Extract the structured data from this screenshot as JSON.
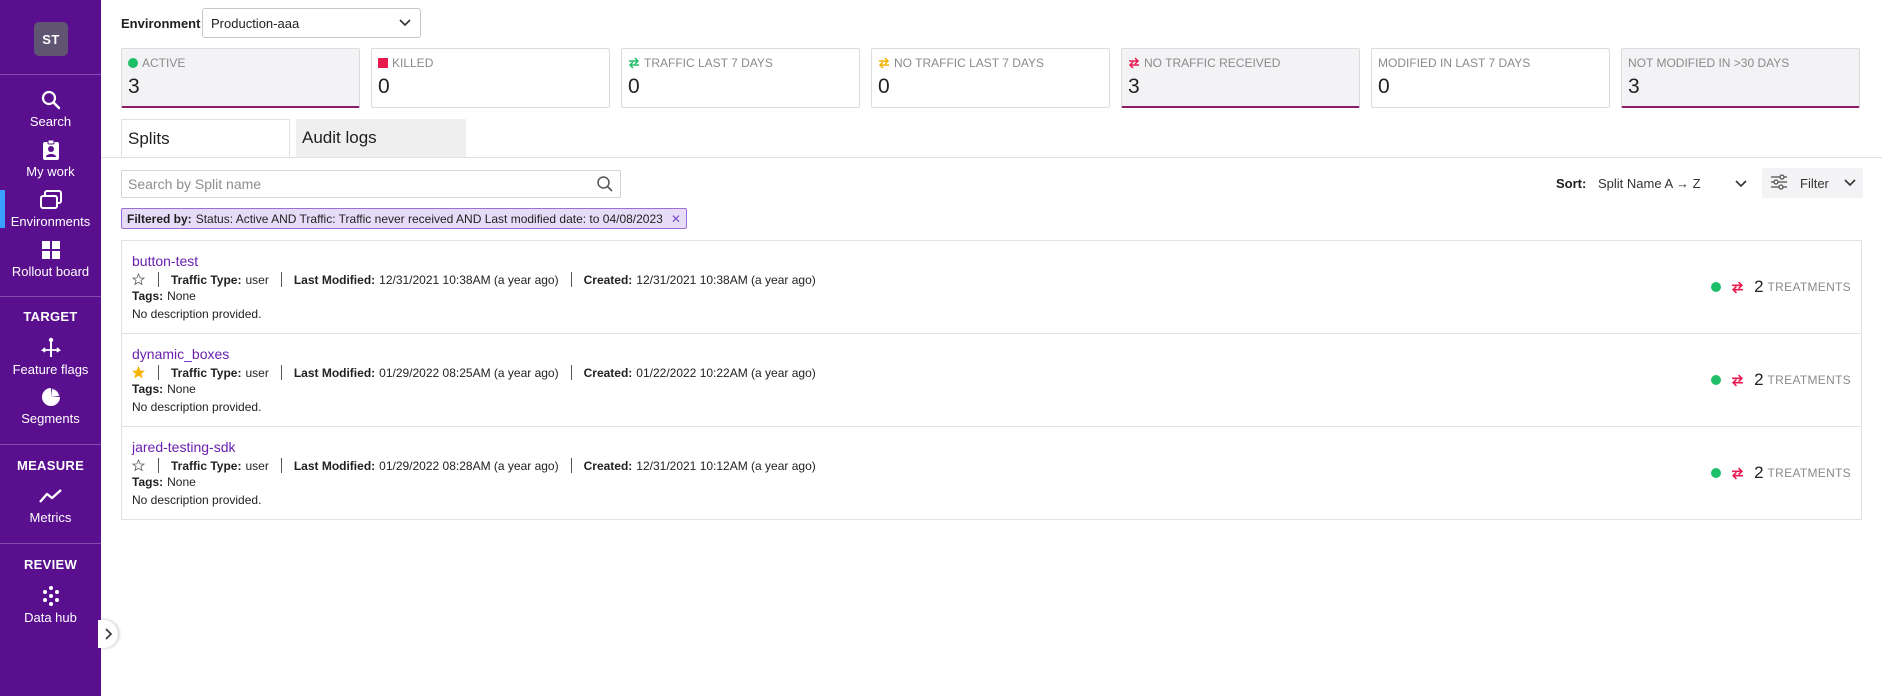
{
  "sidebar": {
    "avatar": "ST",
    "items": [
      {
        "label": "Search",
        "icon": "search-icon"
      },
      {
        "label": "My work",
        "icon": "clipboard-user-icon"
      },
      {
        "label": "Environments",
        "icon": "windows-icon"
      },
      {
        "label": "Rollout board",
        "icon": "grid-icon"
      },
      {
        "label": "Feature flags",
        "icon": "flag-branch-icon"
      },
      {
        "label": "Segments",
        "icon": "pie-chart-icon"
      },
      {
        "label": "Metrics",
        "icon": "line-chart-icon"
      },
      {
        "label": "Data hub",
        "icon": "data-dots-icon"
      }
    ],
    "sections": [
      "TARGET",
      "MEASURE",
      "REVIEW"
    ]
  },
  "environment": {
    "label": "Environment",
    "value": "Production-aaa"
  },
  "stats": [
    {
      "label": "ACTIVE",
      "value": "3",
      "icon": "green-dot-icon"
    },
    {
      "label": "KILLED",
      "value": "0",
      "icon": "red-square-icon"
    },
    {
      "label": "TRAFFIC LAST 7 DAYS",
      "value": "0",
      "icon": "traffic-arrows-icon"
    },
    {
      "label": "NO TRAFFIC LAST 7 DAYS",
      "value": "0",
      "icon": "no-traffic-arrows-icon"
    },
    {
      "label": "NO TRAFFIC RECEIVED",
      "value": "3",
      "icon": "no-traffic-received-icon"
    },
    {
      "label": "MODIFIED IN LAST 7 DAYS",
      "value": "0",
      "icon": ""
    },
    {
      "label": "NOT MODIFIED IN >30 DAYS",
      "value": "3",
      "icon": ""
    }
  ],
  "tabs": [
    {
      "label": "Splits"
    },
    {
      "label": "Audit logs"
    }
  ],
  "search": {
    "placeholder": "Search by Split name",
    "value": ""
  },
  "sort": {
    "label": "Sort:",
    "value": "Split Name A → Z"
  },
  "filter": {
    "label": "Filter"
  },
  "chip": {
    "prefix": "Filtered by:",
    "text": "Status: Active AND Traffic: Traffic never received AND Last modified date: to 04/08/2023"
  },
  "labels": {
    "traffic_type": "Traffic Type:",
    "last_modified": "Last Modified:",
    "created": "Created:",
    "tags": "Tags:",
    "treatments": "TREATMENTS"
  },
  "splits": [
    {
      "name": "button-test",
      "starred": false,
      "traffic_type": "user",
      "last_modified": "12/31/2021 10:38AM (a year ago)",
      "created": "12/31/2021 10:38AM (a year ago)",
      "tags": "None",
      "description": "No description provided.",
      "treatments": "2"
    },
    {
      "name": "dynamic_boxes",
      "starred": true,
      "traffic_type": "user",
      "last_modified": "01/29/2022 08:25AM (a year ago)",
      "created": "01/22/2022 10:22AM (a year ago)",
      "tags": "None",
      "description": "No description provided.",
      "treatments": "2"
    },
    {
      "name": "jared-testing-sdk",
      "starred": false,
      "traffic_type": "user",
      "last_modified": "01/29/2022 08:28AM (a year ago)",
      "created": "12/31/2021 10:12AM (a year ago)",
      "tags": "None",
      "description": "No description provided.",
      "treatments": "2"
    }
  ],
  "colors": {
    "sidebar": "#5a0f8f",
    "link": "#6b1fb1",
    "active_green": "#1fbf6a",
    "killed_red": "#e8194e",
    "highlight_border": "#8a1e6b",
    "chip_bg": "#e7dcf7",
    "star_gold": "#f5b400"
  }
}
